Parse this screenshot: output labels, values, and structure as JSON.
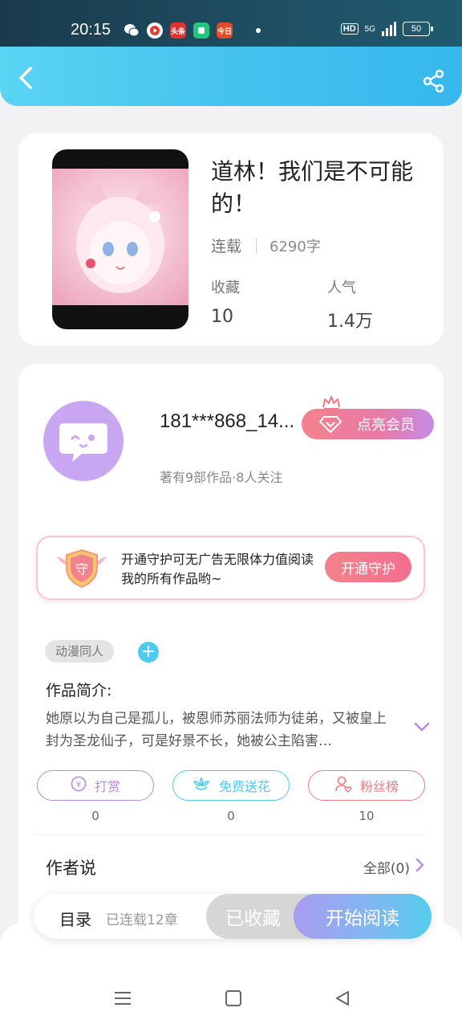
{
  "status_bar": {
    "time": "20:15",
    "network": "5G",
    "hd": "HD",
    "battery": "50",
    "apps": [
      {
        "icon": "wechat-icon",
        "label": ""
      },
      {
        "icon": "video-app-icon",
        "label": ""
      },
      {
        "icon": "toutiao-icon",
        "label": "头条"
      },
      {
        "icon": "green-app-icon",
        "label": ""
      },
      {
        "icon": "news-app-icon",
        "label": "今日"
      }
    ],
    "colors": {
      "bar": "#1f4f63"
    }
  },
  "header": {
    "back_icon": "chevron-left-icon",
    "share_icon": "share-icon",
    "colors": {
      "start": "#5ad4f2",
      "end": "#36b8ee"
    }
  },
  "book": {
    "title": "道林！我们是不可能的！",
    "status": "连载",
    "word_count": "6290字",
    "favorites_label": "收藏",
    "favorites_value": "10",
    "popularity_label": "人气",
    "popularity_value": "1.4万"
  },
  "author": {
    "name": "181***868_14...",
    "vip_button": "点亮会员",
    "stats": "著有9部作品·8人关注",
    "avatar_icon": "chat-bubble-avatar-icon"
  },
  "guard_banner": {
    "badge_char": "守",
    "text": "开通守护可无广告无限体力值阅读我的所有作品哟~",
    "button": "开通守护"
  },
  "work": {
    "tag": "动漫同人",
    "add_tag_symbol": "+",
    "intro_heading": "作品简介:",
    "intro_text": "她原以为自己是孤儿，被恩师苏丽法师为徒弟，又被皇上封为圣龙仙子，可是好景不长，她被公主陷害…"
  },
  "actions": [
    {
      "label": "打赏",
      "icon": "coin-icon",
      "count": "0",
      "color": "#b68ae6"
    },
    {
      "label": "免费送花",
      "icon": "flower-icon",
      "count": "0",
      "color": "#4ccbef"
    },
    {
      "label": "粉丝榜",
      "icon": "fan-user-icon",
      "count": "10",
      "color": "#f07b84"
    }
  ],
  "author_says": {
    "heading": "作者说",
    "all_link": "全部(0)"
  },
  "bottom_bar": {
    "toc": "目录",
    "toc_count": "已连载12章",
    "collected": "已收藏",
    "read": "开始阅读"
  },
  "nav": {
    "menu_icon": "menu-icon",
    "home_icon": "home-square-icon",
    "back_icon": "back-triangle-icon"
  }
}
